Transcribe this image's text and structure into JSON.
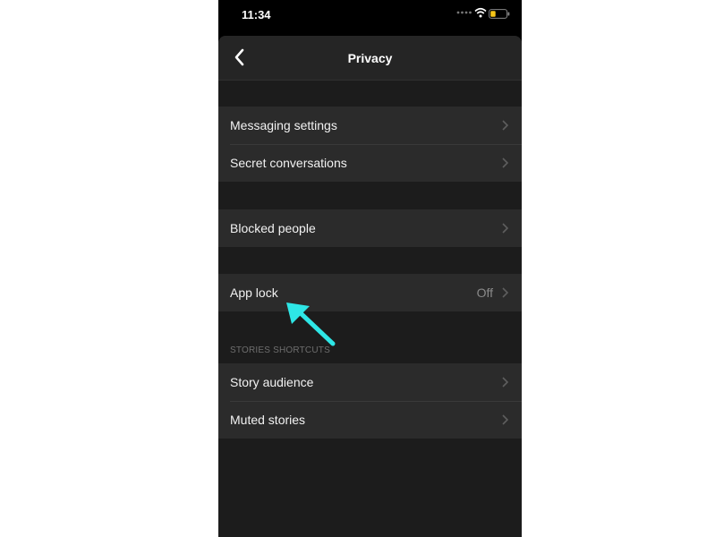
{
  "status_bar": {
    "time": "11:34",
    "icons": [
      "signal-dots-icon",
      "wifi-icon",
      "battery-icon"
    ]
  },
  "header": {
    "title": "Privacy",
    "back_icon": "chevron-left-icon"
  },
  "sections": [
    {
      "items": [
        {
          "label": "Messaging settings"
        },
        {
          "label": "Secret conversations"
        }
      ]
    },
    {
      "items": [
        {
          "label": "Blocked people"
        }
      ]
    },
    {
      "items": [
        {
          "label": "App lock",
          "value": "Off"
        }
      ]
    },
    {
      "header": "STORIES SHORTCUTS",
      "items": [
        {
          "label": "Story audience"
        },
        {
          "label": "Muted stories"
        }
      ]
    }
  ],
  "colors": {
    "background": "#1c1c1c",
    "row_background": "#2b2b2b",
    "annotation_arrow": "#2ee6e6",
    "battery": "#f5c518"
  }
}
